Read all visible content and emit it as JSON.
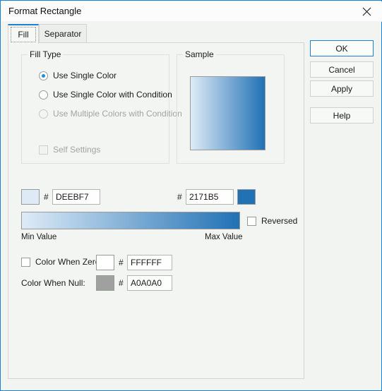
{
  "window": {
    "title": "Format Rectangle",
    "close_icon": "close-icon",
    "border_color": "#1b82d3"
  },
  "tabs": [
    {
      "label": "Fill",
      "selected": true
    },
    {
      "label": "Separator",
      "selected": false
    }
  ],
  "fill_type": {
    "group_label": "Fill Type",
    "options": [
      {
        "label": "Use Single Color",
        "checked": true,
        "disabled": false
      },
      {
        "label": "Use Single Color with Condition",
        "checked": false,
        "disabled": false
      },
      {
        "label": "Use Multiple Colors with Condition",
        "checked": false,
        "disabled": true
      }
    ],
    "self_settings": {
      "label": "Self Settings",
      "checked": false,
      "disabled": true
    }
  },
  "sample": {
    "group_label": "Sample",
    "gradient_from": "#DEEBF7",
    "gradient_to": "#2171B5"
  },
  "colors": {
    "min": {
      "hash": "#",
      "value": "DEEBF7",
      "swatch": "#DEEBF7"
    },
    "max": {
      "hash": "#",
      "value": "2171B5",
      "swatch": "#2171B5"
    },
    "min_label": "Min Value",
    "max_label": "Max Value",
    "reversed": {
      "label": "Reversed",
      "checked": false
    }
  },
  "zero": {
    "label": "Color When Zero:",
    "checked": false,
    "hash": "#",
    "value": "FFFFFF",
    "swatch": "#FFFFFF"
  },
  "nullv": {
    "label": "Color When Null:",
    "hash": "#",
    "value": "A0A0A0",
    "swatch": "#A0A0A0"
  },
  "buttons": {
    "ok": "OK",
    "cancel": "Cancel",
    "apply": "Apply",
    "help": "Help"
  }
}
